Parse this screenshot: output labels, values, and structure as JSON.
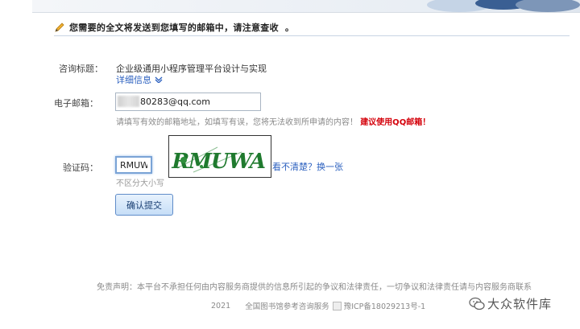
{
  "notice": {
    "text": "您需要的全文将发送到您填写的邮箱中，请注意查收",
    "dot": "。"
  },
  "form": {
    "title_label": "咨询标题：",
    "title_value": "企业级通用小程序管理平台设计与实现",
    "detail_link": "详细信息",
    "email_label": "电子邮箱：",
    "email_value": "80283@qq.com",
    "email_hint": "请填写有效的邮箱地址，如填写有误，您将无法收到所申请的内容！",
    "email_warn": "建议使用QQ邮箱！",
    "captcha_label": "验证码：",
    "captcha_value": "RMUWA",
    "captcha_image_text": "RMUWA",
    "refresh_link": "看不清楚？换一张",
    "case_note": "不区分大小写",
    "submit_label": "确认提交"
  },
  "footer": {
    "disclaimer": "免责声明：本平台不承担任何由内容服务商提供的信息所引起的争议和法律责任，一切争议和法律责任请与内容服务商联系",
    "year": "2021",
    "org": "全国图书馆参考咨询服务",
    "icp": "豫ICP备18029213号-1"
  },
  "watermark": {
    "text": "大众软件库",
    "icon": "wechat-icon"
  }
}
